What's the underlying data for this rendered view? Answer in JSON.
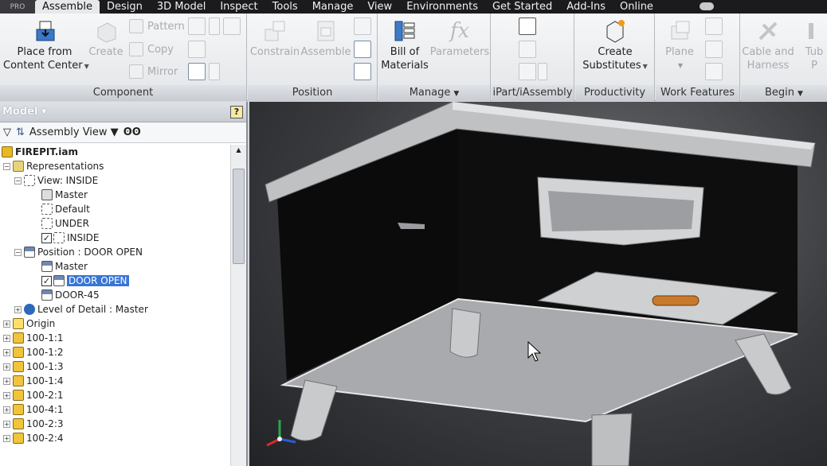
{
  "app": {
    "logo_text": "PRO"
  },
  "tabs": [
    "Assemble",
    "Design",
    "3D Model",
    "Inspect",
    "Tools",
    "Manage",
    "View",
    "Environments",
    "Get Started",
    "Add-Ins",
    "Online"
  ],
  "active_tab": "Assemble",
  "ribbon": {
    "component": {
      "title": "Component",
      "place_line1": "Place from",
      "place_line2": "Content Center",
      "create": "Create",
      "pattern": "Pattern",
      "copy": "Copy",
      "mirror": "Mirror"
    },
    "position": {
      "title": "Position",
      "constrain": "Constrain",
      "assemble": "Assemble"
    },
    "manage": {
      "title": "Manage",
      "bom_line1": "Bill of",
      "bom_line2": "Materials",
      "parameters": "Parameters",
      "parameters_glyph": "fx"
    },
    "ipart": {
      "title": "iPart/iAssembly"
    },
    "productivity": {
      "title": "Productivity",
      "cs_line1": "Create",
      "cs_line2": "Substitutes"
    },
    "work_features": {
      "title": "Work Features",
      "plane": "Plane"
    },
    "begin": {
      "title": "Begin",
      "cable_line1": "Cable and",
      "cable_line2": "Harness",
      "tube_line1": "Tub",
      "tube_line2": "P"
    }
  },
  "browser": {
    "header": "Model",
    "view_selector": "Assembly View",
    "tree": [
      {
        "label": "FIREPIT.iam",
        "bold": true
      },
      {
        "label": "Representations"
      },
      {
        "label": "View: INSIDE"
      },
      {
        "label": "Master"
      },
      {
        "label": "Default"
      },
      {
        "label": "UNDER"
      },
      {
        "label": "INSIDE",
        "checked": true
      },
      {
        "label": "Position : DOOR OPEN"
      },
      {
        "label": "Master"
      },
      {
        "label": "DOOR OPEN",
        "checked": true,
        "selected": true
      },
      {
        "label": "DOOR-45"
      },
      {
        "label": "Level of Detail : Master"
      },
      {
        "label": "Origin"
      },
      {
        "label": "100-1:1"
      },
      {
        "label": "100-1:2"
      },
      {
        "label": "100-1:3"
      },
      {
        "label": "100-1:4"
      },
      {
        "label": "100-2:1"
      },
      {
        "label": "100-4:1"
      },
      {
        "label": "100-2:3"
      },
      {
        "label": "100-2:4"
      }
    ]
  },
  "colors": {
    "tab_bar": "#1b1b1d",
    "selection": "#3875d7",
    "viewport_dark": "#222326"
  }
}
